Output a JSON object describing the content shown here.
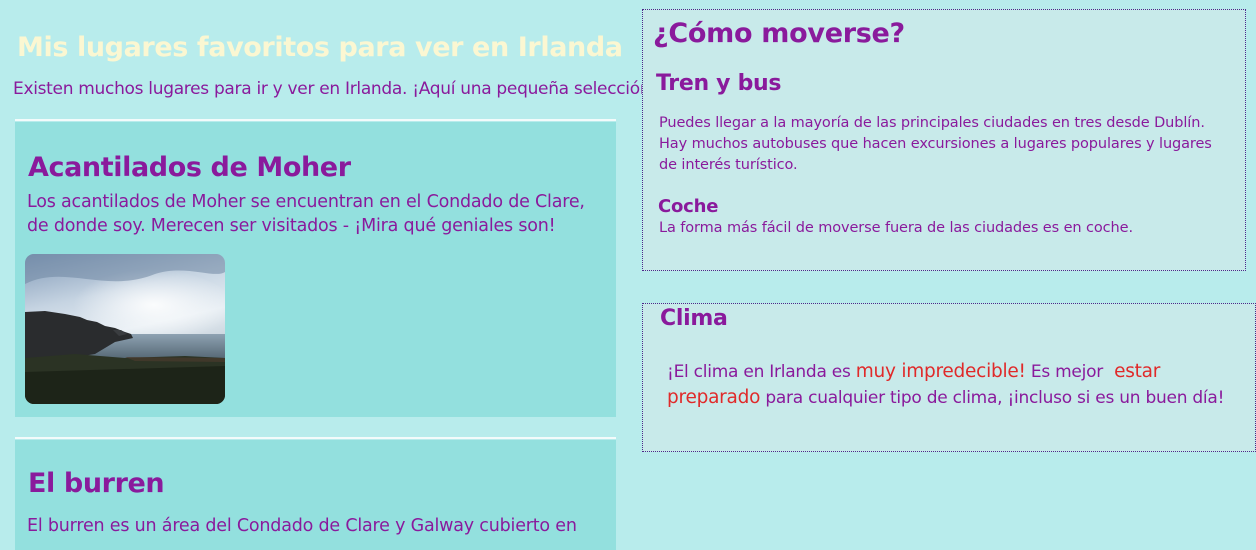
{
  "page": {
    "title": "Mis lugares favoritos para ver en Irlanda",
    "intro": "Existen muchos lugares para ir y ver en Irlanda. ¡Aquí una pequeña selección!"
  },
  "places": [
    {
      "title": "Acantilados de Moher",
      "text": "Los acantilados de Moher se encuentran en el Condado de Clare, de donde soy. Merecen ser visitados - ¡Mira qué geniales son!"
    },
    {
      "title": "El burren",
      "text": "El burren es un área del Condado de Clare y Galway cubierto en"
    }
  ],
  "transport": {
    "title": "¿Cómo moverse?",
    "train_bus": {
      "title": "Tren y bus",
      "line1": "Puedes llegar a la mayoría de las principales ciudades en tres desde Dublín.",
      "line2": "Hay muchos autobuses que hacen excursiones a lugares populares y lugares de interés turístico."
    },
    "car": {
      "title": "Coche",
      "text": "La forma más fácil de moverse fuera de las ciudades es en coche."
    }
  },
  "weather": {
    "title": "Clima",
    "text_a": "¡El clima en Irlanda es ",
    "highlight_1": "muy impredecible!",
    "text_b": " Es mejor ",
    "highlight_2": "estar preparado",
    "text_c": " para cualquier tipo de clima, ¡incluso si es un buen día!"
  },
  "colors": {
    "background": "#b8ecec",
    "card": "#93e0de",
    "box": "#c8eaea",
    "text": "#8a1a9c",
    "page_title": "#fbf7d2",
    "highlight": "#e02a2a"
  }
}
